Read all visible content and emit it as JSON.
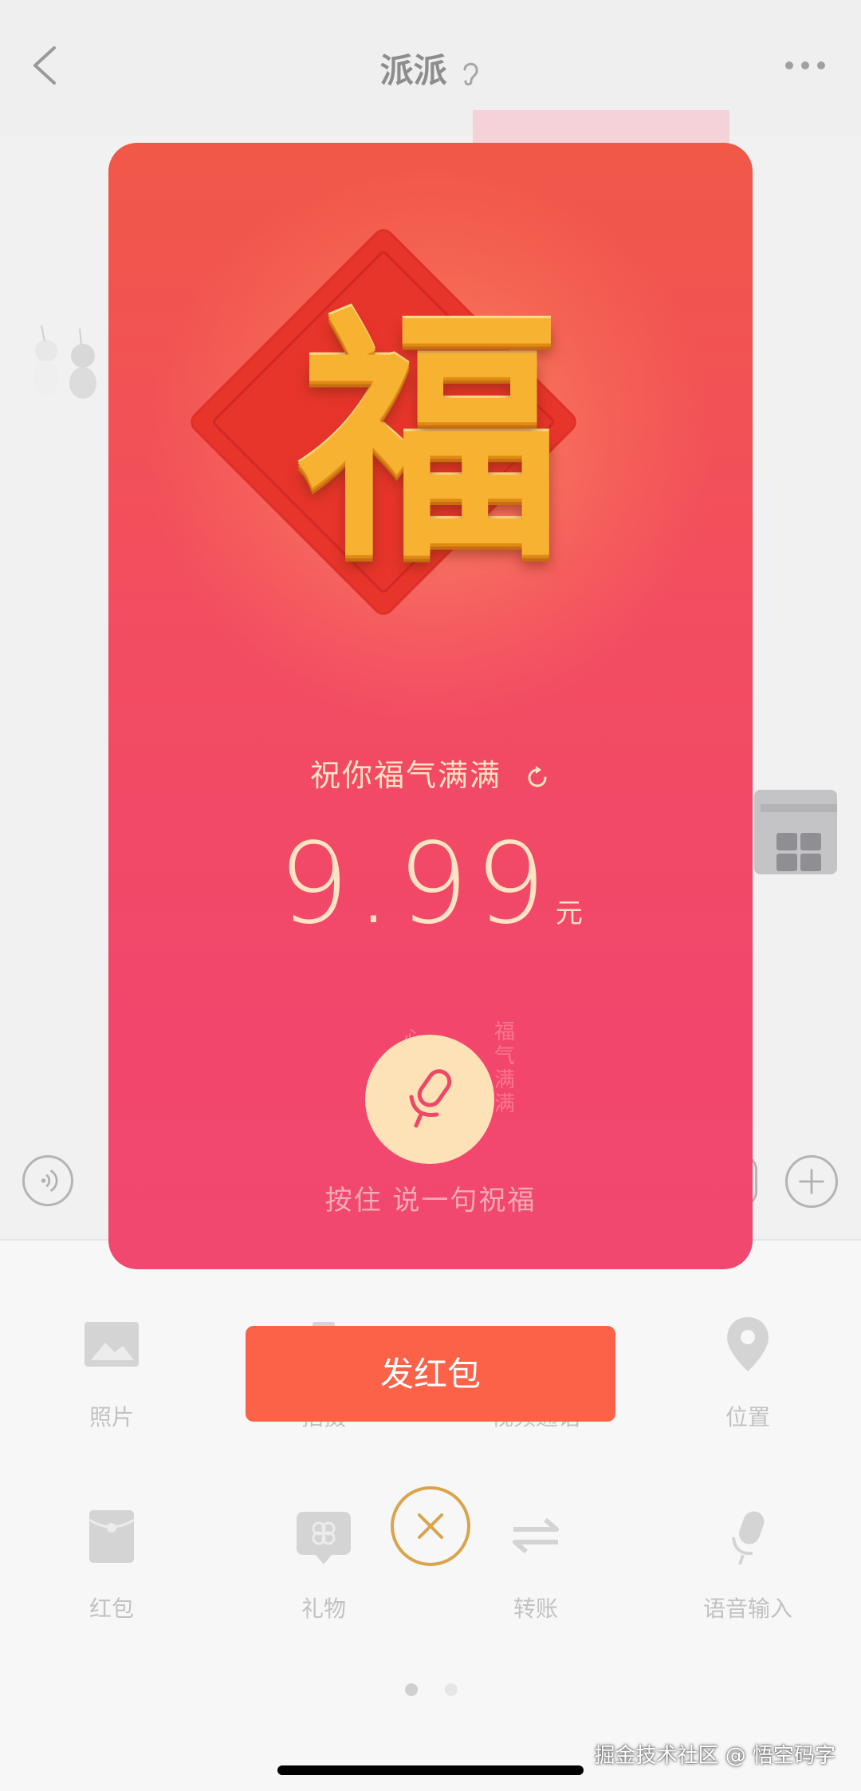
{
  "chat": {
    "title": "派派",
    "title_icon": "ear-icon"
  },
  "modal": {
    "emblem_char": "福",
    "blessing": "祝你福气满满",
    "amount": "9.99",
    "unit": "元",
    "hint": "按住 说一句祝福",
    "faint_bless": "福气满满",
    "faint_left": "心"
  },
  "send_button_label": "发红包",
  "toolbar": {
    "items": [
      {
        "label": "照片",
        "icon": "photo-icon"
      },
      {
        "label": "拍摄",
        "icon": "camera-icon"
      },
      {
        "label": "视频通话",
        "icon": "video-call-icon"
      },
      {
        "label": "位置",
        "icon": "location-icon"
      },
      {
        "label": "红包",
        "icon": "red-packet-icon"
      },
      {
        "label": "礼物",
        "icon": "gift-icon"
      },
      {
        "label": "转账",
        "icon": "transfer-icon"
      },
      {
        "label": "语音输入",
        "icon": "microphone-icon"
      }
    ]
  },
  "pager": {
    "current": 1,
    "total": 2
  },
  "watermark": "掘金技术社区 @ 悟空码字",
  "colors": {
    "packet_top": "#f15848",
    "packet_bottom": "#f14870",
    "gold": "#f7b232",
    "send_button": "#fb6248",
    "amount_text": "#ffe3c2"
  }
}
